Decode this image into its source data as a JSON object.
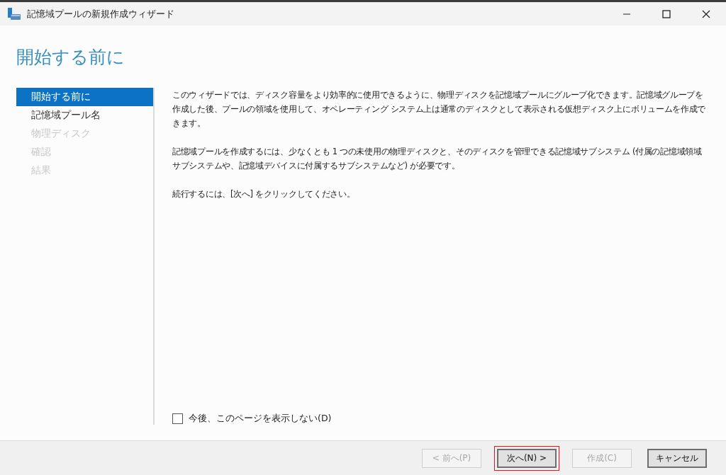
{
  "window": {
    "title": "記憶域プールの新規作成ウィザード"
  },
  "heading": "開始する前に",
  "steps": [
    {
      "label": "開始する前に",
      "selected": true,
      "disabled": false
    },
    {
      "label": "記憶域プール名",
      "selected": false,
      "disabled": false
    },
    {
      "label": "物理ディスク",
      "selected": false,
      "disabled": true
    },
    {
      "label": "確認",
      "selected": false,
      "disabled": true
    },
    {
      "label": "結果",
      "selected": false,
      "disabled": true
    }
  ],
  "paragraphs": [
    "このウィザードでは、ディスク容量をより効率的に使用できるように、物理ディスクを記憶域プールにグループ化できます。記憶域グループを作成した後、プールの領域を使用して、オペレーティング システム上は通常のディスクとして表示される仮想ディスク上にボリュームを作成できます。",
    "記憶域プールを作成するには、少なくとも 1 つの未使用の物理ディスクと、そのディスクを管理できる記憶域サブシステム (付属の記憶域領域サブシステムや、記憶域デバイスに付属するサブシステムなど) が必要です。",
    "続行するには、[次へ] をクリックしてください。"
  ],
  "dont_show_again": {
    "label": "今後、このページを表示しない(D)",
    "checked": false
  },
  "buttons": [
    {
      "label": "< 前へ(P)",
      "disabled": true,
      "highlighted": false,
      "default": false
    },
    {
      "label": "次へ(N) >",
      "disabled": false,
      "highlighted": true,
      "default": true
    },
    {
      "label": "作成(C)",
      "disabled": true,
      "highlighted": false,
      "default": false
    },
    {
      "label": "キャンセル",
      "disabled": false,
      "highlighted": false,
      "default": true
    }
  ]
}
